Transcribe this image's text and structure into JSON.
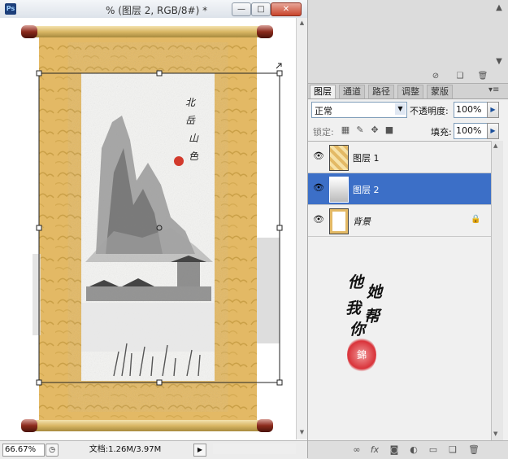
{
  "window": {
    "title": "% (图层 2, RGB/8#) *",
    "app_badge": "Ps",
    "minimize": "—",
    "maximize": "□",
    "close": "✕"
  },
  "status": {
    "zoom": "66.67%",
    "doc_info": "文档:1.26M/3.97M"
  },
  "artwork": {
    "calligraphy": [
      "北",
      "岳",
      "山",
      "色"
    ]
  },
  "layers_panel": {
    "tabs": [
      "图层",
      "通道",
      "路径",
      "调整",
      "蒙版"
    ],
    "blend_mode": "正常",
    "opacity_label": "不透明度:",
    "opacity_value": "100%",
    "lock_label": "锁定:",
    "fill_label": "填充:",
    "fill_value": "100%",
    "layers": [
      {
        "name": "图层 1",
        "visible": true,
        "selected": false
      },
      {
        "name": "图层 2",
        "visible": true,
        "selected": true
      },
      {
        "name": "背景",
        "visible": true,
        "selected": false,
        "locked": true
      }
    ]
  },
  "watermark": {
    "lines": [
      "他",
      "她",
      "我",
      "帮",
      "你"
    ],
    "seal_text": "錦"
  },
  "colors": {
    "selected_layer": "#3c6fc7",
    "scroll_gold": "#e0b75e",
    "rod": "#8b2a1c"
  }
}
